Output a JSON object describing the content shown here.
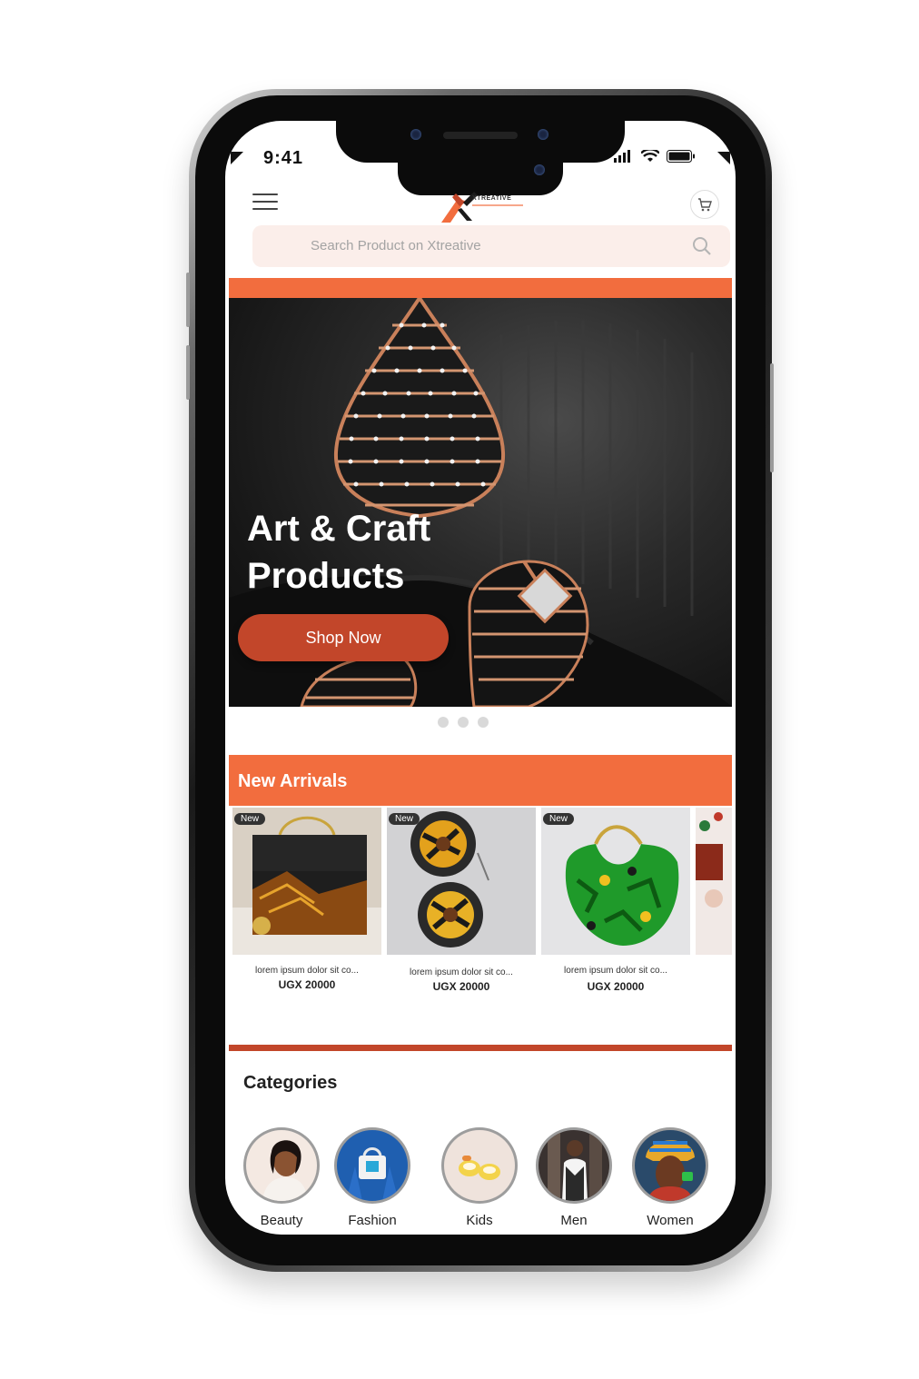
{
  "status_bar": {
    "time": "9:41"
  },
  "header": {
    "menu_icon": "hamburger-icon",
    "logo_text": "XTREATIVE",
    "cart_icon": "cart-icon"
  },
  "search": {
    "placeholder": "Search Product on Xtreative",
    "icon": "search-icon"
  },
  "banner": {
    "title_line1": "Art & Craft",
    "title_line2": "Products",
    "cta_label": "Shop Now",
    "dots_count": 3
  },
  "new_arrivals": {
    "title": "New Arrivals",
    "products": [
      {
        "badge": "New",
        "name": "lorem ipsum dolor sit co...",
        "price": "UGX 20000"
      },
      {
        "badge": "New",
        "name": "lorem ipsum dolor sit co...",
        "price": "UGX 20000"
      },
      {
        "badge": "New",
        "name": "lorem ipsum dolor sit co...",
        "price": "UGX 20000"
      }
    ]
  },
  "categories": {
    "title": "Categories",
    "items": [
      {
        "label": "Beauty"
      },
      {
        "label": "Fashion"
      },
      {
        "label": "Kids"
      },
      {
        "label": "Men"
      },
      {
        "label": "Women"
      }
    ]
  },
  "colors": {
    "accent": "#f26d3e",
    "cta": "#c2462a",
    "search_bg": "#fbeeea"
  }
}
